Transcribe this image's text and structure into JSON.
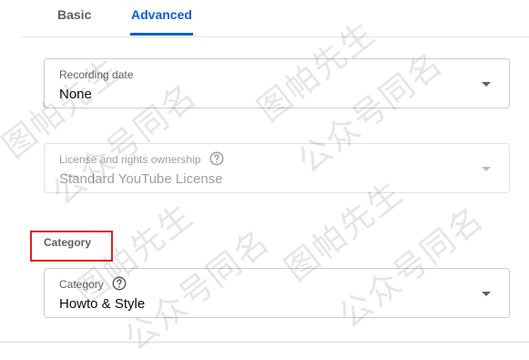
{
  "tabs": {
    "basic": "Basic",
    "advanced": "Advanced",
    "active": "Advanced"
  },
  "recording_date": {
    "label": "Recording date",
    "value": "None"
  },
  "license": {
    "label": "License and rights ownership",
    "value": "Standard YouTube License",
    "disabled": true
  },
  "category_section": {
    "heading": "Category"
  },
  "category": {
    "label": "Category",
    "value": "Howto & Style"
  },
  "watermark": {
    "line1": "图帕先生",
    "line2": "公众号同名"
  },
  "colors": {
    "accent": "#065fd4",
    "highlight": "#e02020"
  }
}
